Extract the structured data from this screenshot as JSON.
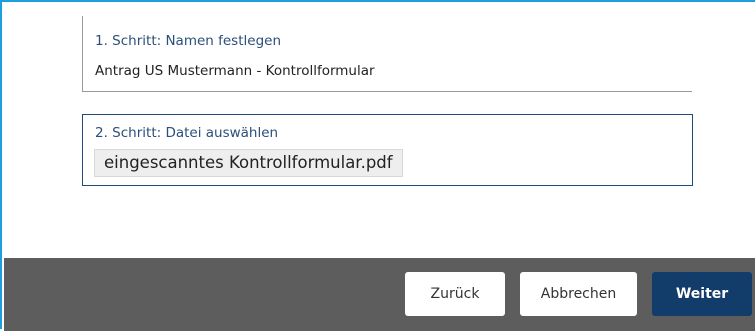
{
  "step1": {
    "label": "1. Schritt: Namen festlegen",
    "value": "Antrag US Mustermann - Kontrollformular"
  },
  "step2": {
    "label": "2. Schritt: Datei auswählen",
    "selected_file": "eingescanntes Kontrollformular.pdf"
  },
  "footer": {
    "back_label": "Zurück",
    "cancel_label": "Abbrechen",
    "next_label": "Weiter"
  },
  "colors": {
    "frame_border": "#1aa0dc",
    "step_label": "#2a4f7a",
    "active_box_border": "#1e4d7b",
    "footer_bg": "#5d5d5d",
    "primary_button": "#123d6b"
  }
}
